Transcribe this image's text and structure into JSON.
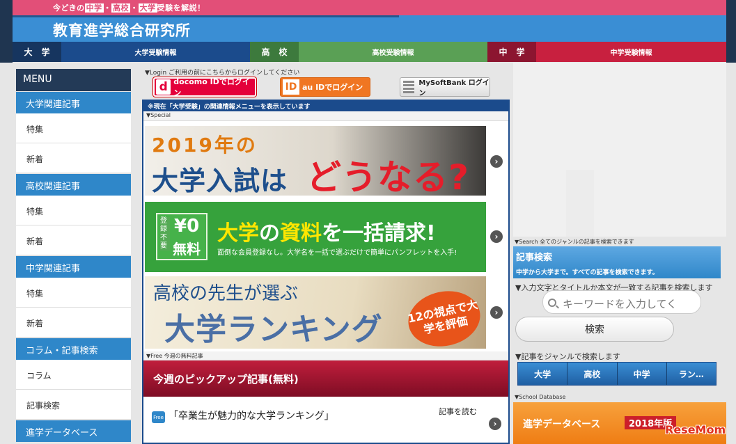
{
  "header": {
    "tagline_prefix": "今どきの",
    "tagline_chu": "中学",
    "tagline_sep1": "・",
    "tagline_ko": "高校",
    "tagline_sep2": "・",
    "tagline_dai": "大学",
    "tagline_suffix": "受験を解説！",
    "site_title": "教育進学総合研究所"
  },
  "nav": [
    {
      "label_a": "大",
      "label_b": "学",
      "info": "大学受験情報"
    },
    {
      "label_a": "高",
      "label_b": "校",
      "info": "高校受験情報"
    },
    {
      "label_a": "中",
      "label_b": "学",
      "info": "中学受験情報"
    }
  ],
  "menu": {
    "title": "MENU",
    "categories": [
      {
        "label": "大学関連記事",
        "items": [
          "特集",
          "新着"
        ]
      },
      {
        "label": "高校関連記事",
        "items": [
          "特集",
          "新着"
        ]
      },
      {
        "label": "中学関連記事",
        "items": [
          "特集",
          "新着"
        ]
      },
      {
        "label": "コラム・記事検索",
        "items": [
          "コラム",
          "記事検索"
        ]
      },
      {
        "label": "進学データベース",
        "items": []
      }
    ]
  },
  "login": {
    "label": "▼Login ご利用の前にこちらからログインしてください",
    "docomo_mark": "d",
    "docomo": "docomo IDでログイン",
    "au_mark": "ID",
    "au": "au IDでログイン",
    "softbank": "MySoftBank ログイン"
  },
  "center": {
    "now_notice": "※現在「大学受験」の関連情報メニューを表示しています",
    "special_label": "▼Special",
    "banner1": {
      "line1": "2019年の",
      "line2": "大学入試は",
      "line3": "どうなる?"
    },
    "banner2": {
      "small": "登録不要",
      "yen": "¥0",
      "muryo": "無料",
      "headline_a": "大学",
      "headline_b": "の",
      "headline_c": "資料",
      "headline_d": "を一括請求!",
      "sub": "面倒な会員登録なし。大学名を一括で選ぶだけで簡単にパンフレットを入手!"
    },
    "banner3": {
      "line1": "高校の先生が選ぶ",
      "line2": "大学ランキング",
      "badge": "12の視点で大学を評価"
    },
    "arrow": "›",
    "free_label": "▼Free 今週の無料記事",
    "pickup_head": "今週のピックアップ記事(無料)",
    "free_badge": "Free",
    "pickup_title": "「卒業生が魅力的な大学ランキング」",
    "read_more": "記事を読む"
  },
  "search": {
    "label": "▼Search 全てのジャンルの記事を検索できます",
    "title": "記事検索",
    "subtitle": "中学から大学まで。すべての記事を検索できます。",
    "desc": "▼入力文字とタイトルか本文が一致する記事を検索します",
    "placeholder": "キーワードを入力してく",
    "button": "検索",
    "genre_label": "▼記事をジャンルで検索します",
    "genres": [
      "大学",
      "高校",
      "中学",
      "ラン…"
    ]
  },
  "database": {
    "label": "▼School Database",
    "title": "進学データベース",
    "year": "2018年版"
  },
  "watermark": "ReseMom"
}
